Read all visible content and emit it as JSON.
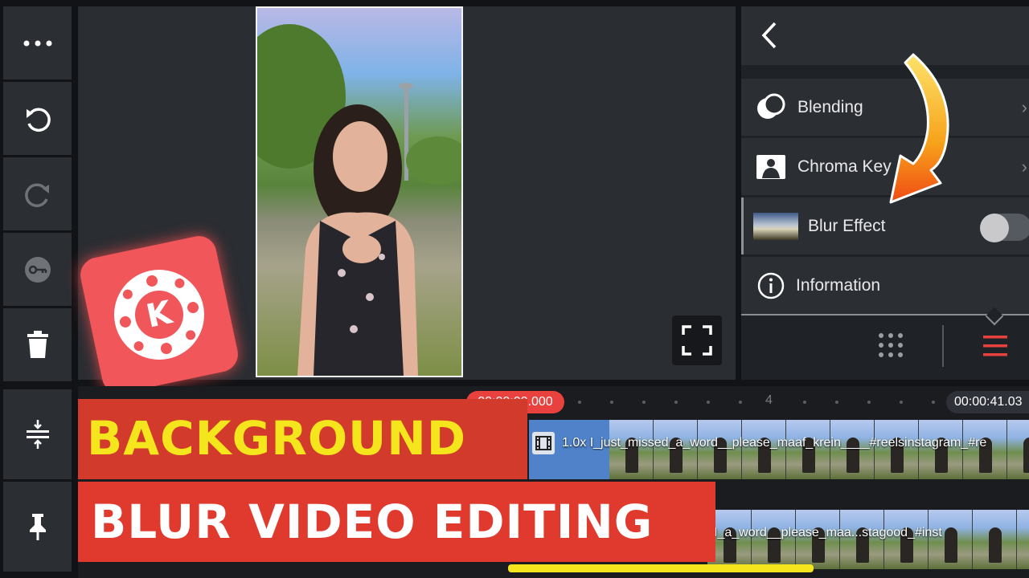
{
  "toolbar": {
    "items": [
      "more-icon",
      "undo-icon",
      "redo-icon",
      "keyframe-icon",
      "delete-icon",
      "split-height-icon",
      "pin-icon"
    ]
  },
  "panel": {
    "back_icon": "chevron-left-icon",
    "rows": [
      {
        "label": "Blending",
        "icon": "blending-icon"
      },
      {
        "label": "Chroma Key",
        "icon": "chroma-key-icon"
      },
      {
        "label": "Blur Effect",
        "icon": "blur-thumbnail",
        "toggle": false
      },
      {
        "label": "Information",
        "icon": "info-icon"
      }
    ],
    "accent": "#e8413e"
  },
  "timeline": {
    "current_time": "00:00:00.000",
    "end_time": "00:00:41.03",
    "marker": "4",
    "clip_label": "1.0x I_just_missed_a_word__please_maaf_krein____#reelsinstagram_#re",
    "clip2_label": "I_a_word__please_maa...stagood_#inst"
  },
  "overlay": {
    "headline_top": "BACKGROUND",
    "headline_bottom": "BLUR VIDEO EDITING",
    "logo_letter": "K"
  },
  "colors": {
    "headline_yellow": "#f5e51c",
    "headline_red": "#e03a2f",
    "logo_red": "#f0565a"
  }
}
